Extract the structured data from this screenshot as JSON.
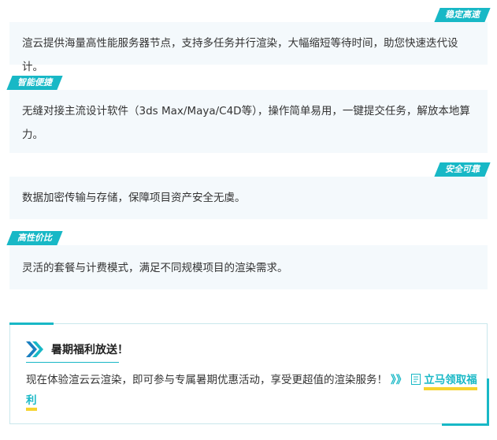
{
  "features": [
    {
      "tag": "稳定高速",
      "text": "渲云提供海量高性能服务器节点，支持多任务并行渲染，大幅缩短等待时间，助您快速迭代设计。"
    },
    {
      "tag": "智能便捷",
      "text": "无缝对接主流设计软件（3ds Max/Maya/C4D等），操作简单易用，一键提交任务，解放本地算力。"
    },
    {
      "tag": "安全可靠",
      "text": "数据加密传输与存储，保障项目资产安全无虞。"
    },
    {
      "tag": "高性价比",
      "text": "灵活的套餐与计费模式，满足不同规模项目的渲染需求。"
    }
  ],
  "promo": {
    "title": "暑期福利放送！",
    "text": "现在体验渲云云渲染，即可参与专属暑期优惠活动，享受更超值的渲染服务！",
    "arrows": "》》",
    "link": "立马领取福利"
  },
  "colors": {
    "accent": "#18b8c6",
    "box_bg": "#f4f9fc",
    "highlight": "#f6d32d"
  },
  "icons": {
    "promo": "double-chevron-right-icon",
    "link": "document-icon"
  }
}
